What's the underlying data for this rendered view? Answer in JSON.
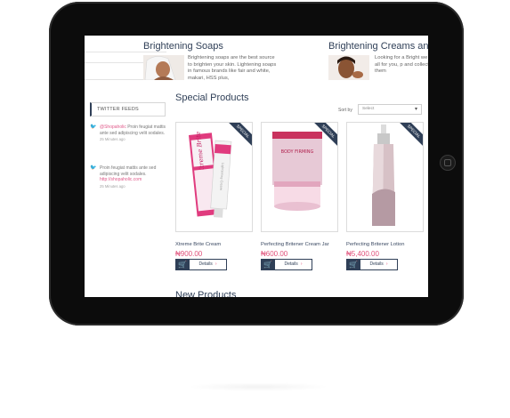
{
  "sidebar": {
    "twitter_feeds_label": "TWITTER FEEDS",
    "tweets": [
      {
        "handle": "@Shopaholic",
        "text": "Proin feugiat mattis ante sed adipiscing velit sodales.",
        "time": "25 Minutes ago"
      },
      {
        "text": "Proin feugiat mattis ante sed adipiscing velit sodales.",
        "link": "http://shopaholic.com",
        "time": "25 Minutes ago"
      }
    ]
  },
  "categories": [
    {
      "title": "Brightening Soaps",
      "description": "Brightening soaps are the best source to brighten your skin. Lightening soaps in famous brands like fair and white, makari, HSS plus,"
    },
    {
      "title": "Brightening Creams and G",
      "description": "Looking for a Bright we got all for you, p and collected them"
    }
  ],
  "special_products": {
    "title": "Special Products",
    "sort_by_label": "Sort by",
    "sort_select_value": "Select",
    "ribbon_label": "SPECIAL",
    "cart_icon": "cart-icon",
    "details_label": "Details",
    "products": [
      {
        "name": "Xtreme Brite Cream",
        "price": "₦900.00",
        "box_brand": "Xtreme Brite",
        "tube_text": "Lightening Cream"
      },
      {
        "name": "Perfecting Britener Cream Jar",
        "price": "₦600.00",
        "box_text": "BODY FIRMING"
      },
      {
        "name": "Perfecting Britener Lotion",
        "price": "₦5,400.00"
      }
    ]
  },
  "new_products": {
    "title": "New Products"
  },
  "colors": {
    "accent": "#e0507a",
    "navy": "#2f3f57",
    "tablet": "#0c0c0c"
  }
}
